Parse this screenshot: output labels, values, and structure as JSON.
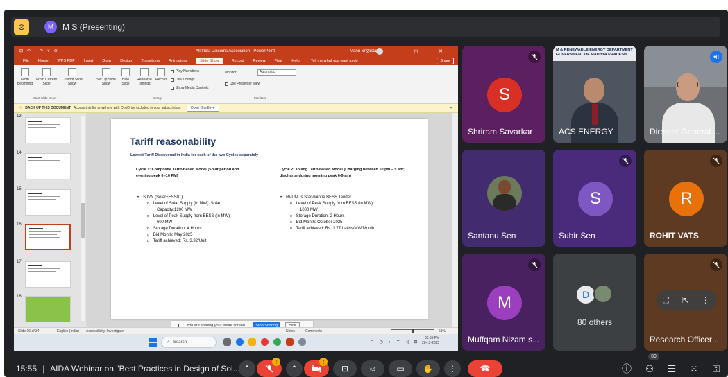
{
  "presenter_bar": {
    "avatar_initials": "M",
    "presenter_label": "M S (Presenting)"
  },
  "powerpoint": {
    "quick_access": "⊟ ↶ · ↷ ⊽ ⊕ · ·",
    "window_title": "All India Discoms Association - PowerPoint",
    "user_name": "Manu Srivastava",
    "window_controls": "⊡ − ◻ ✕",
    "menu": {
      "file": "File",
      "home": "Home",
      "wps_pdf": "WPS PDF",
      "insert": "Insert",
      "draw": "Draw",
      "design": "Design",
      "transitions": "Transitions",
      "animations": "Animations",
      "slide_show": "Slide Show",
      "record": "Record",
      "review": "Review",
      "view": "View",
      "help": "Help",
      "tell_me": "Tell me what you want to do",
      "share": "Share"
    },
    "ribbon": {
      "from_beginning": "From Beginning",
      "from_current_slide": "From Current Slide",
      "custom_slide_show": "Custom Slide Show",
      "group_start": "Start Slide Show",
      "set_up_slide_show": "Set Up Slide Show",
      "hide_slide": "Hide Slide",
      "rehearse_timings": "Rehearse Timings",
      "record": "Record",
      "play_narrations": "Play Narrations",
      "use_timings": "Use Timings",
      "show_media_controls": "Show Media Controls",
      "group_setup": "Set Up",
      "monitor_label": "Monitor:",
      "monitor_value": "Automatic",
      "use_presenter_view": "Use Presenter View",
      "group_monitors": "Monitors"
    },
    "message_bar": {
      "title": "BACK UP THIS DOCUMENT",
      "text": "Access this file anywhere with OneDrive included in your subscription.",
      "button": "Open OneDrive",
      "close": "✕"
    },
    "thumbnail_numbers": [
      "13",
      "14",
      "15",
      "16",
      "17",
      "18"
    ],
    "slide": {
      "title": "Tariff reasonability",
      "subtitle": "Lowest Tariff Discovered in India for each of the two Cycles separately",
      "cycle1_heading": "Cycle 1: Composite Tariff-Based Model (Solar period and evening peak 6 -10 PM)",
      "cycle1_bullet": "SJVN (Solar+ESS01)",
      "cycle1_items": [
        "Level of Solar Supply (in MW): Solar",
        "Capacity:1200 MW",
        "Level of Peak Supply from BESS (in MW):",
        "600 MW",
        "Storage Duration: 4 Hours",
        "Bid Month: May 2025",
        "Tariff achieved: Rs. 3.32/Unit"
      ],
      "cycle2_heading": "Cycle 2: Tolling Tariff-Based Model (Charging between 10 pm – 5 am; discharge during morning peak 6-9 am)",
      "cycle2_bullet": "RVUNL's Standalone BESS Tender",
      "cycle2_items": [
        "Level of Peak Supply from BESS (in MW):",
        "1000 MW",
        "Storage Duration: 2 Hours",
        "Bid Month: October 2025",
        "Tariff achieved: Rs. 1.77 Lakhs/MW/Month"
      ]
    },
    "share_bar": {
      "text": "You are sharing your entire screen.",
      "stop": "Stop Sharing",
      "hide": "Hide"
    },
    "status_bar": {
      "slide_of": "Slide 16 of 34",
      "language": "English (India)",
      "accessibility": "Accessibility: Investigate",
      "notes": "Notes",
      "comments": "Comments",
      "zoom": "61%"
    },
    "taskbar": {
      "search": "Search",
      "time": "03:55 PM",
      "date": "20-11-2025"
    }
  },
  "participants": [
    {
      "name": "Shriram Savarkar",
      "initial": "S",
      "bg": "#5c1f5f",
      "avatar": "#d93025"
    },
    {
      "name": "ACS ENERGY",
      "banner": "M & RENEWABLE ENERGY DEPARTMENT GOVERNMENT OF MADHYA PRADESH"
    },
    {
      "name": "Director General ..."
    },
    {
      "name": "Santanu Sen"
    },
    {
      "name": "Subir Sen",
      "initial": "S",
      "bg": "#4a2a7a",
      "avatar": "#7e57c2"
    },
    {
      "name": "ROHIT VATS",
      "initial": "R",
      "bg": "#5e3a23",
      "avatar": "#e8710a"
    },
    {
      "name": "Muffqam Nizam s...",
      "initial": "M",
      "bg": "#4a2160",
      "avatar": "#9c3fbf"
    },
    {
      "name": "80 others",
      "initial": "D"
    },
    {
      "name": "Research Officer ..."
    }
  ],
  "bottom_bar": {
    "time": "15:55",
    "meeting_title": "AIDA Webinar on \"Best Practices in Design of Sol...",
    "participant_count": "89"
  },
  "colors": {
    "meet_bg": "#202124",
    "ppt_accent": "#c43e1c",
    "hangup": "#ea4335",
    "warning": "#f9ab00"
  }
}
